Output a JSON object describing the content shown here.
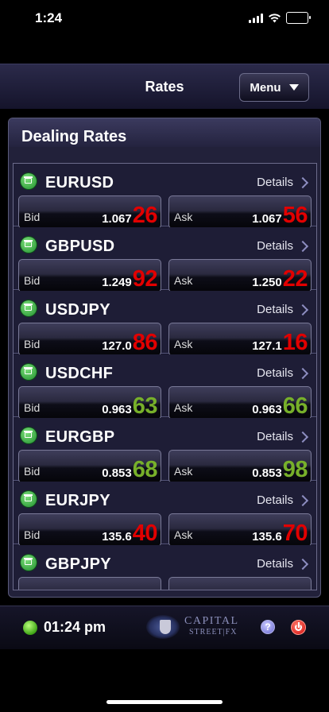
{
  "status_bar": {
    "time": "1:24"
  },
  "nav": {
    "title": "Rates",
    "menu_label": "Menu"
  },
  "main": {
    "title": "Dealing Rates",
    "details_label": "Details"
  },
  "rates": [
    {
      "pair": "EURUSD",
      "bid": {
        "label": "Bid",
        "prefix": "1.067",
        "pips": "26",
        "color": "#e10000"
      },
      "ask": {
        "label": "Ask",
        "prefix": "1.067",
        "pips": "56",
        "color": "#e10000"
      }
    },
    {
      "pair": "GBPUSD",
      "bid": {
        "label": "Bid",
        "prefix": "1.249",
        "pips": "92",
        "color": "#e10000"
      },
      "ask": {
        "label": "Ask",
        "prefix": "1.250",
        "pips": "22",
        "color": "#e10000"
      }
    },
    {
      "pair": "USDJPY",
      "bid": {
        "label": "Bid",
        "prefix": "127.0",
        "pips": "86",
        "color": "#e10000"
      },
      "ask": {
        "label": "Ask",
        "prefix": "127.1",
        "pips": "16",
        "color": "#e10000"
      }
    },
    {
      "pair": "USDCHF",
      "bid": {
        "label": "Bid",
        "prefix": "0.963",
        "pips": "63",
        "color": "#77b02a"
      },
      "ask": {
        "label": "Ask",
        "prefix": "0.963",
        "pips": "66",
        "color": "#77b02a"
      }
    },
    {
      "pair": "EURGBP",
      "bid": {
        "label": "Bid",
        "prefix": "0.853",
        "pips": "68",
        "color": "#77b02a"
      },
      "ask": {
        "label": "Ask",
        "prefix": "0.853",
        "pips": "98",
        "color": "#77b02a"
      }
    },
    {
      "pair": "EURJPY",
      "bid": {
        "label": "Bid",
        "prefix": "135.6",
        "pips": "40",
        "color": "#e10000"
      },
      "ask": {
        "label": "Ask",
        "prefix": "135.6",
        "pips": "70",
        "color": "#e10000"
      }
    },
    {
      "pair": "GBPJPY"
    }
  ],
  "footer": {
    "time": "01:24 pm",
    "brand_top": "CAPITAL",
    "brand_bottom": "STREET|FX",
    "help_label": "?"
  }
}
